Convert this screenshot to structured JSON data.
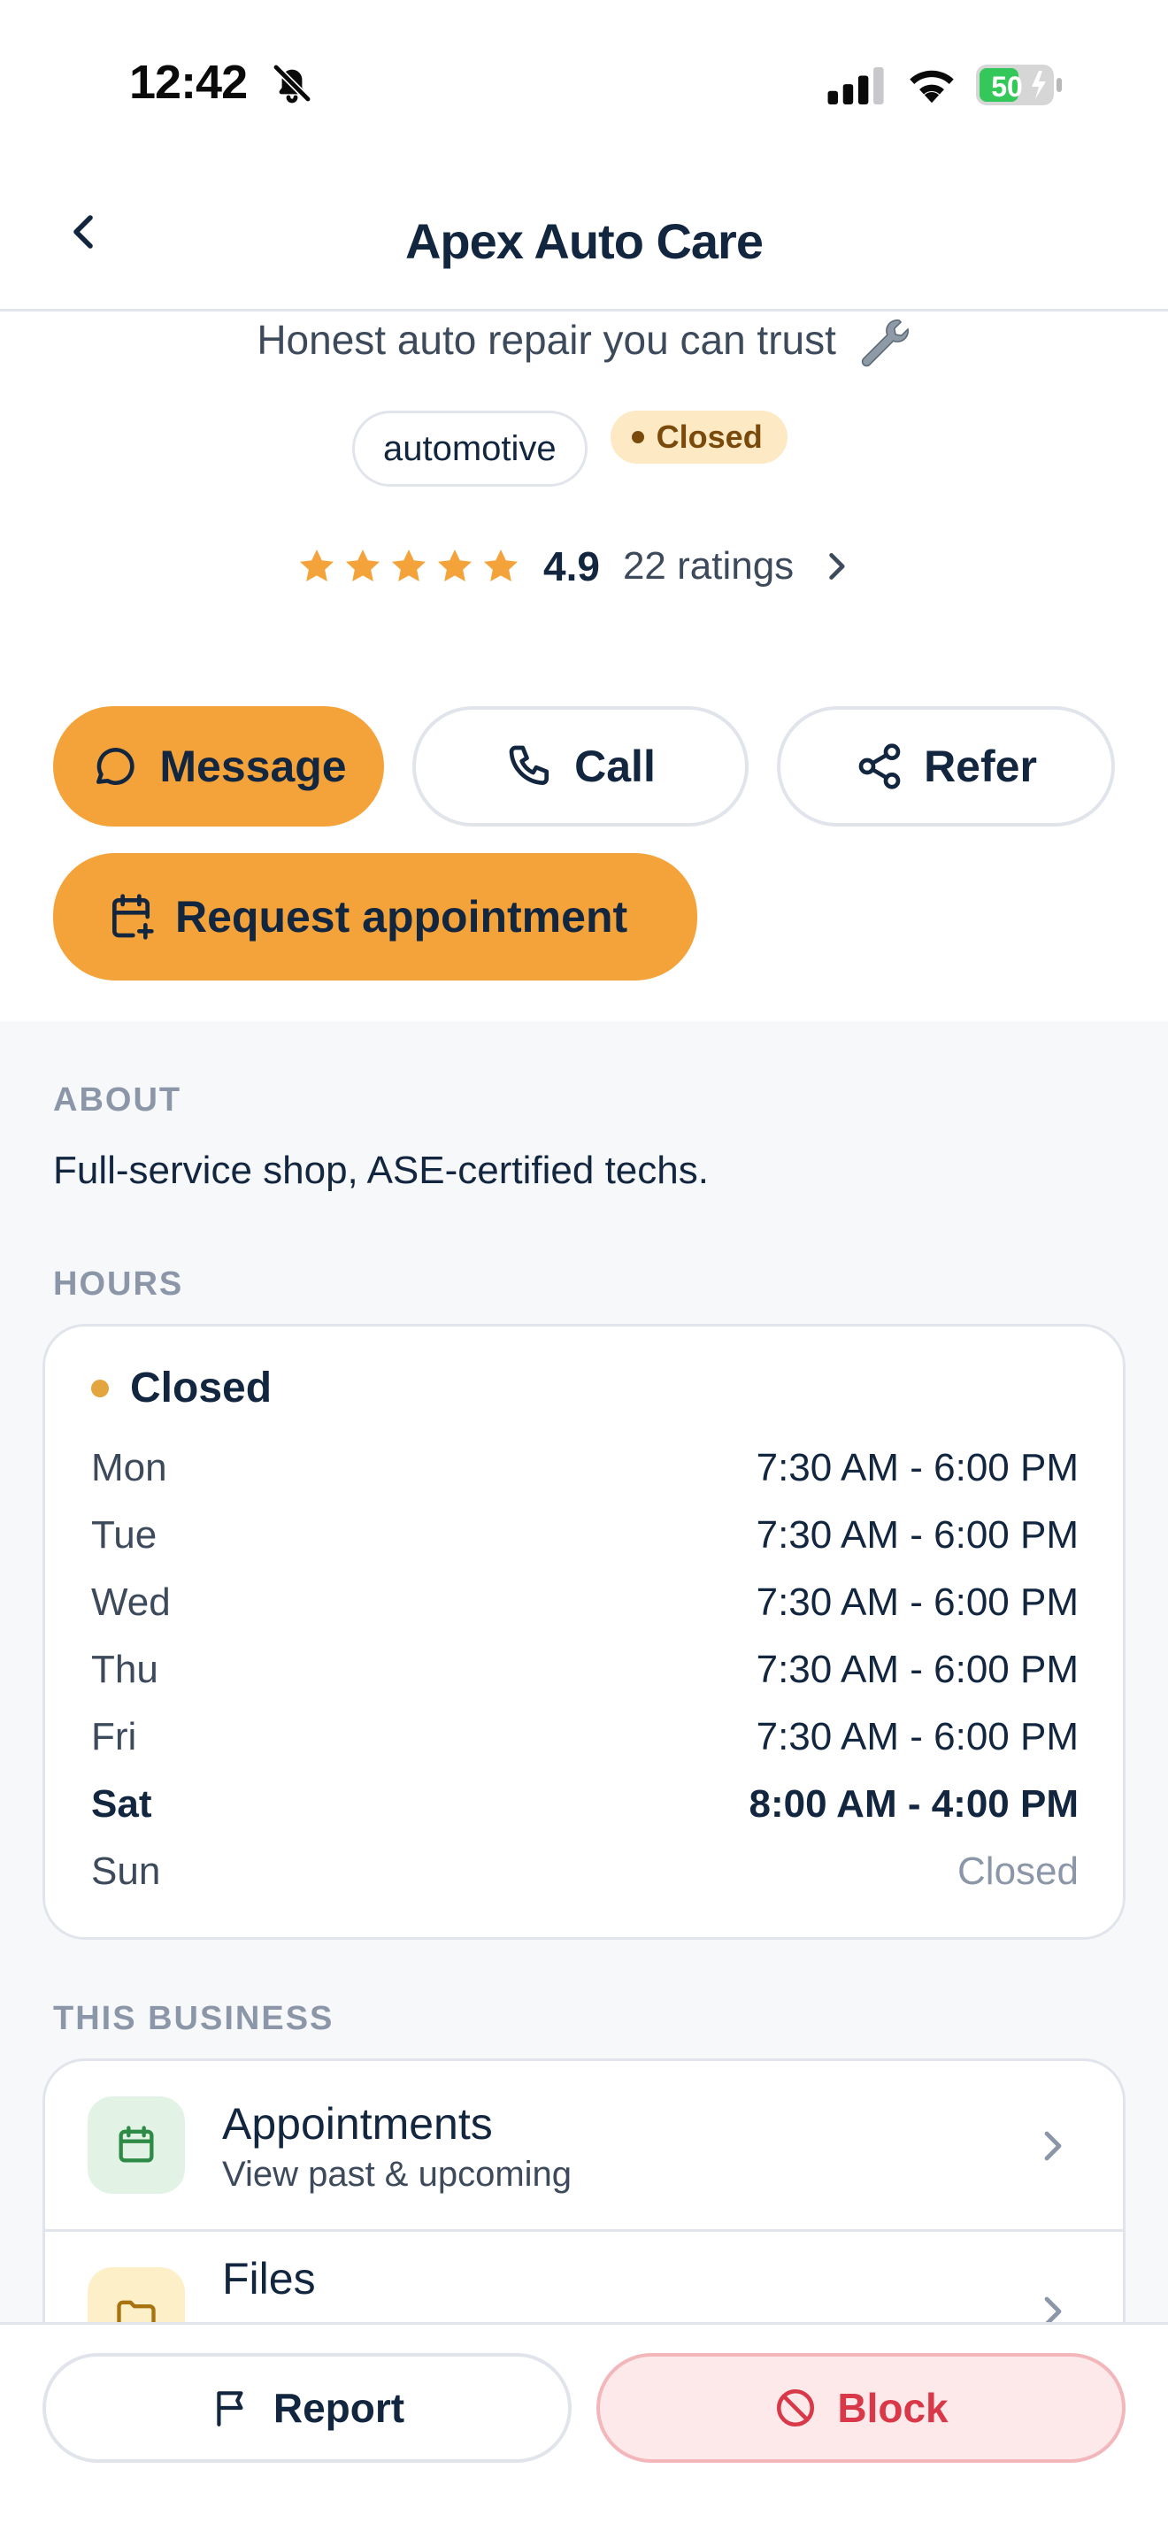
{
  "status_bar": {
    "time": "12:42",
    "battery": "50"
  },
  "nav": {
    "title": "Apex Auto Care"
  },
  "header": {
    "tagline": "Honest auto repair you can trust",
    "category_tag": "automotive",
    "status_tag": "Closed",
    "rating_value": "4.9",
    "rating_stars": 5,
    "rating_count": "22 ratings"
  },
  "actions": {
    "message": "Message",
    "call": "Call",
    "refer": "Refer",
    "request_appointment": "Request appointment"
  },
  "about": {
    "label": "ABOUT",
    "text": "Full-service shop, ASE-certified techs."
  },
  "hours": {
    "label": "HOURS",
    "status": "Closed",
    "rows": [
      {
        "day": "Mon",
        "time": "7:30 AM - 6:00 PM"
      },
      {
        "day": "Tue",
        "time": "7:30 AM - 6:00 PM"
      },
      {
        "day": "Wed",
        "time": "7:30 AM - 6:00 PM"
      },
      {
        "day": "Thu",
        "time": "7:30 AM - 6:00 PM"
      },
      {
        "day": "Fri",
        "time": "7:30 AM - 6:00 PM"
      },
      {
        "day": "Sat",
        "time": "8:00 AM - 4:00 PM"
      },
      {
        "day": "Sun",
        "time": "Closed"
      }
    ]
  },
  "business": {
    "label": "THIS BUSINESS",
    "items": [
      {
        "title": "Appointments",
        "subtitle": "View past & upcoming"
      },
      {
        "title": "Files",
        "subtitle": ""
      }
    ]
  },
  "bottom_bar": {
    "report": "Report",
    "block": "Block"
  },
  "colors": {
    "accent": "#f4a33b",
    "star": "#f4a33b",
    "closed_badge_bg": "#fde9c4",
    "block_red": "#d93848",
    "text_dark": "#13263f"
  }
}
